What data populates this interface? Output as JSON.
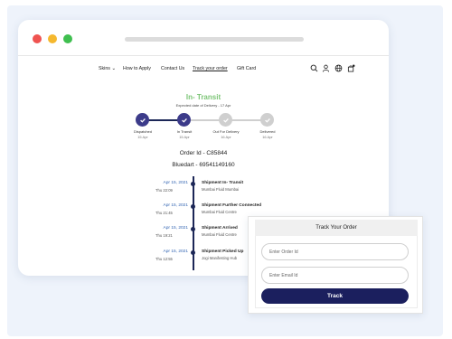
{
  "window": {
    "controls": [
      "close",
      "minimize",
      "maximize"
    ]
  },
  "nav": {
    "items": [
      {
        "label": "Skins",
        "icon": "chevron-down-icon"
      },
      {
        "label": "How to Apply"
      },
      {
        "label": "Contact Us"
      },
      {
        "label": "Track your order",
        "active": true
      },
      {
        "label": "Gift Card"
      }
    ],
    "icons": [
      "search-icon",
      "user-icon",
      "globe-icon",
      "cart-icon"
    ]
  },
  "status": {
    "title": "In- Transit",
    "expected": "Expected date of Delivery - 17 Apr"
  },
  "steps": [
    {
      "label": "Dispatched",
      "date": "15 Apr",
      "done": true
    },
    {
      "label": "In Transit",
      "date": "15 Apr",
      "done": true
    },
    {
      "label": "Out For Delivery",
      "date": "16 Apr",
      "done": false
    },
    {
      "label": "Delivered",
      "date": "16 Apr",
      "done": false
    }
  ],
  "order": {
    "id_text": "Order Id - C85844",
    "carrier_text": "Bluedart - 69541149160"
  },
  "timeline": [
    {
      "date": "Apr 15, 2021",
      "time": "Thu 22:09",
      "title": "Shipment In- Transit",
      "location": "Mumbai Fluid Mumbai"
    },
    {
      "date": "Apr 15, 2021",
      "time": "Thu 21:45",
      "title": "Shipment Further Connected",
      "location": "Mumbai Fluid Centre"
    },
    {
      "date": "Apr 15, 2021",
      "time": "Thu 19:21",
      "title": "Shipment Arrived",
      "location": "Mumbai Fluid Centre"
    },
    {
      "date": "Apr 15, 2021",
      "time": "Thu 12:55",
      "title": "Shipment Picked Up",
      "location": "Jogi Manifesting Hub"
    }
  ],
  "track_form": {
    "header": "Track Your Order",
    "order_placeholder": "Enter Order Id",
    "email_placeholder": "Enter Email Id",
    "button_label": "Track"
  },
  "colors": {
    "accent_navy": "#1c2757",
    "status_green": "#7cc576",
    "step_pending": "#cfcfcf",
    "button": "#1b1f5e"
  }
}
